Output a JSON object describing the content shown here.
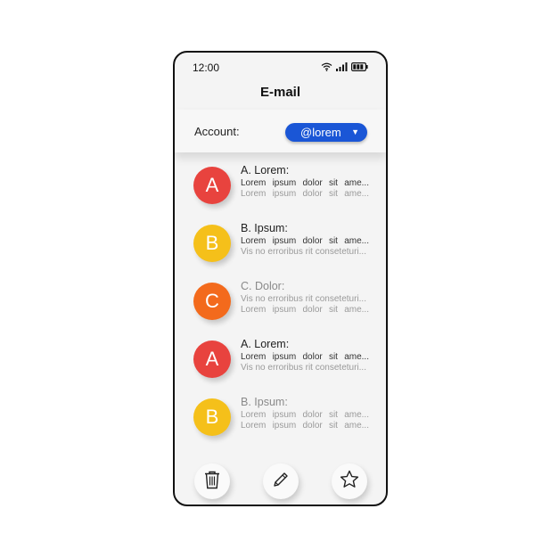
{
  "status_bar": {
    "time": "12:00",
    "icons": [
      "wifi-icon",
      "signal-icon",
      "battery-icon"
    ]
  },
  "app": {
    "title": "E-mail"
  },
  "account": {
    "label": "Account:",
    "value": "@lorem"
  },
  "colors": {
    "accent": "#1a56d6",
    "avatar_red": "#e8433e",
    "avatar_yellow": "#f5c01a",
    "avatar_orange": "#f36a1c"
  },
  "emails": [
    {
      "initial": "A",
      "color": "#e8433e",
      "subject": "A. Lorem:",
      "line1": "Lorem ipsum dolor sit ame...",
      "line2": "Lorem ipsum dolor sit ame...",
      "unread": true
    },
    {
      "initial": "B",
      "color": "#f5c01a",
      "subject": "B. Ipsum:",
      "line1": "Lorem ipsum dolor sit ame...",
      "line2": "Vis no erroribus rit conseteturi...",
      "unread": true
    },
    {
      "initial": "C",
      "color": "#f36a1c",
      "subject": "C. Dolor:",
      "line1": "Vis no erroribus rit conseteturi...",
      "line2": "Lorem ipsum dolor sit ame...",
      "unread": false
    },
    {
      "initial": "A",
      "color": "#e8433e",
      "subject": "A. Lorem:",
      "line1": "Lorem ipsum dolor sit ame...",
      "line2": "Vis no erroribus rit conseteturi...",
      "unread": true
    },
    {
      "initial": "B",
      "color": "#f5c01a",
      "subject": "B. Ipsum:",
      "line1": "Lorem ipsum dolor sit ame...",
      "line2": "Lorem ipsum dolor sit ame...",
      "unread": false
    }
  ],
  "toolbar": {
    "icons": [
      "trash-icon",
      "pencil-icon",
      "star-icon"
    ]
  }
}
